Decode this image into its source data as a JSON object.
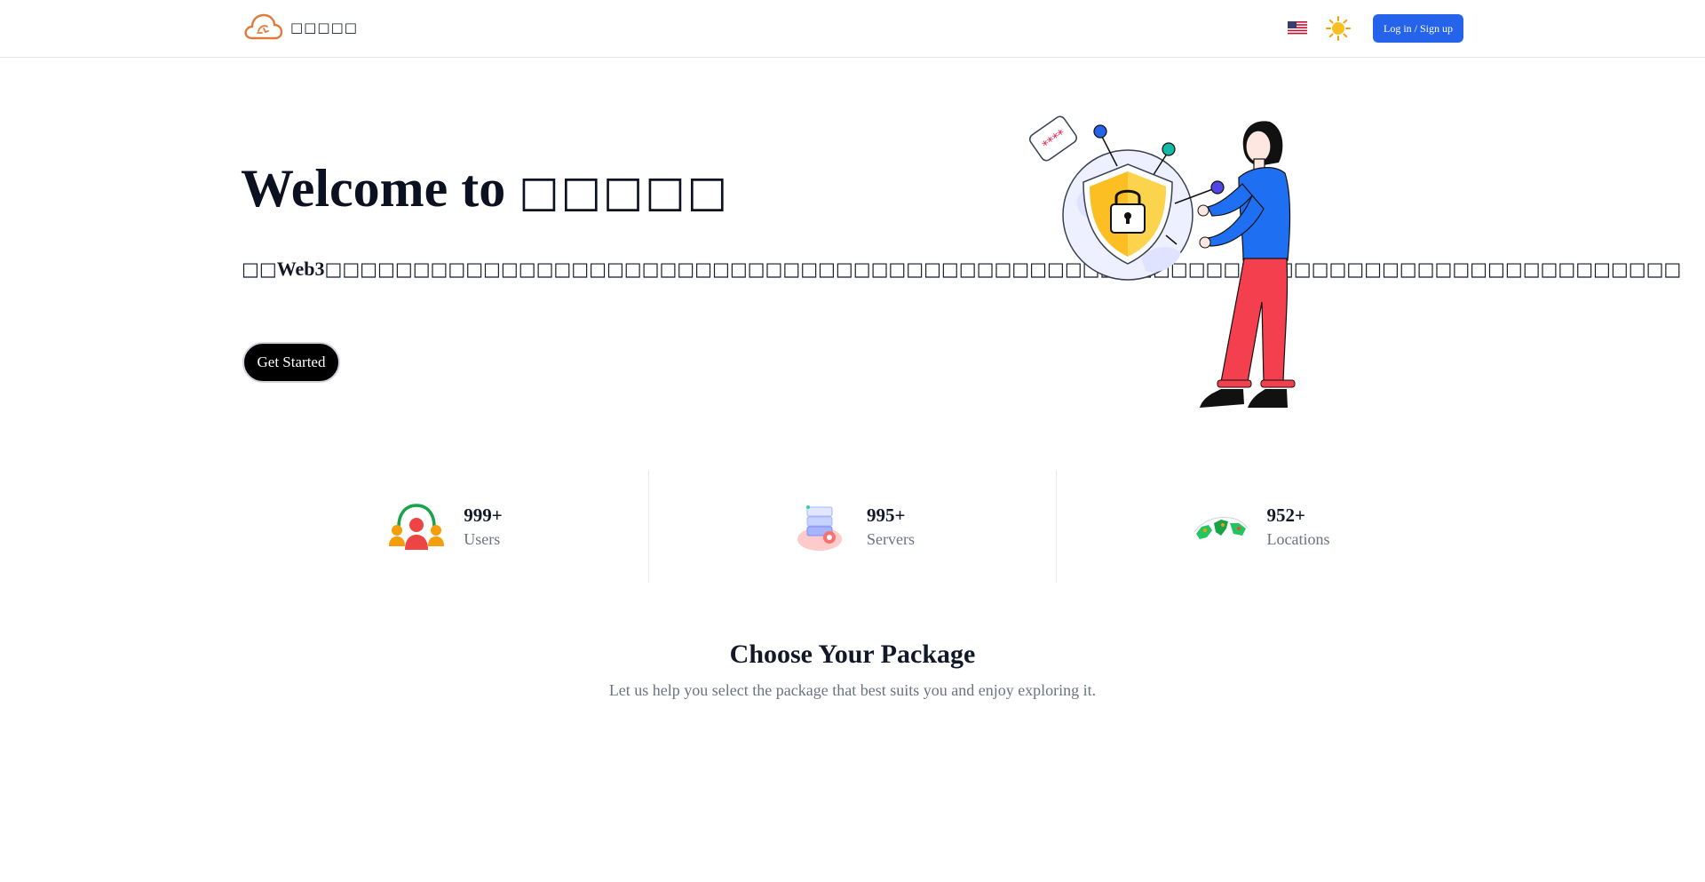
{
  "header": {
    "brand_name": "□□□□□",
    "login_label": "Log in / Sign up",
    "language_icon": "us-flag-icon",
    "theme_icon": "sun-icon"
  },
  "hero": {
    "title_prefix": "Welcome to ",
    "title_brand": "□□□□□",
    "desc_lead": "□□",
    "desc_bold": "Web3",
    "desc_rest": "□□□□□□□□□□□□□□□□□□□□□□□□□□□□□□□□□□□□□□□□□□□□□□□□□□□□□□□□□□□□□□□□□□□□□□□□□□□□□",
    "cta_label": "Get Started",
    "illustration_icon": "security-shield-woman-illustration"
  },
  "stats": [
    {
      "value": "999+",
      "label": "Users",
      "icon": "users-icon"
    },
    {
      "value": "995+",
      "label": "Servers",
      "icon": "servers-icon"
    },
    {
      "value": "952+",
      "label": "Locations",
      "icon": "world-map-icon"
    }
  ],
  "packages": {
    "title": "Choose Your Package",
    "subtitle": "Let us help you select the package that best suits you and enjoy exploring it."
  },
  "colors": {
    "primary": "#2563eb",
    "brand_orange": "#e07a3c",
    "text_dark": "#111827",
    "text_muted": "#6b7280"
  }
}
